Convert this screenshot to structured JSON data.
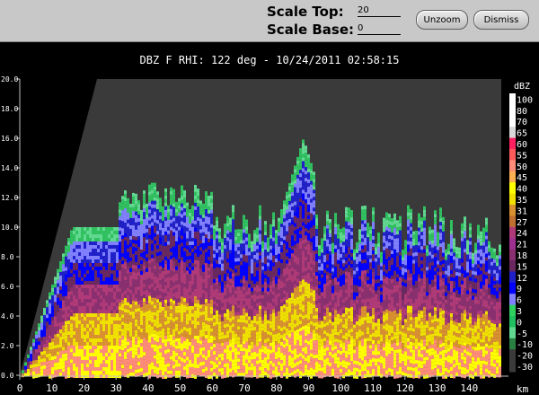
{
  "controls": {
    "scale_top_label": "Scale Top:",
    "scale_top_value": "20",
    "scale_base_label": "Scale Base:",
    "scale_base_value": "0",
    "unzoom_label": "Unzoom",
    "dismiss_label": "Dismiss"
  },
  "plot": {
    "title": "DBZ F  RHI: 122 deg  -  10/24/2011 02:58:15",
    "x_unit": "km",
    "x_ticks": [
      "0",
      "10",
      "20",
      "30",
      "40",
      "50",
      "60",
      "70",
      "80",
      "90",
      "100",
      "110",
      "120",
      "130",
      "140"
    ],
    "y_ticks": [
      "0.0",
      "2.0",
      "4.0",
      "6.0",
      "8.0",
      "10.0",
      "12.0",
      "14.0",
      "16.0",
      "18.0",
      "20.0"
    ],
    "ylim": [
      0,
      20
    ],
    "xlim": [
      0,
      150
    ]
  },
  "colorbar": {
    "unit": "dBZ",
    "levels": [
      {
        "label": "100",
        "color": "#ffffff"
      },
      {
        "label": "80",
        "color": "#ffffff"
      },
      {
        "label": "70",
        "color": "#ffffff"
      },
      {
        "label": "65",
        "color": "#d8d8d8"
      },
      {
        "label": "60",
        "color": "#ff2060"
      },
      {
        "label": "55",
        "color": "#ff5a5a"
      },
      {
        "label": "50",
        "color": "#ff8c78"
      },
      {
        "label": "45",
        "color": "#ffb050"
      },
      {
        "label": "40",
        "color": "#ffff00"
      },
      {
        "label": "35",
        "color": "#f0e000"
      },
      {
        "label": "31",
        "color": "#d89030"
      },
      {
        "label": "27",
        "color": "#c07030"
      },
      {
        "label": "24",
        "color": "#b03a78"
      },
      {
        "label": "21",
        "color": "#a03090"
      },
      {
        "label": "18",
        "color": "#8a3070"
      },
      {
        "label": "15",
        "color": "#6a2860"
      },
      {
        "label": "12",
        "color": "#2020c8"
      },
      {
        "label": "9",
        "color": "#0000ff"
      },
      {
        "label": "6",
        "color": "#8080ff"
      },
      {
        "label": "3",
        "color": "#30d060"
      },
      {
        "label": "0",
        "color": "#20c060"
      },
      {
        "label": "-5",
        "color": "#60d890"
      },
      {
        "label": "-10",
        "color": "#2a8040"
      },
      {
        "label": "-20",
        "color": "#3a3a3a"
      },
      {
        "label": "-30",
        "color": "#3a3a3a"
      }
    ]
  }
}
